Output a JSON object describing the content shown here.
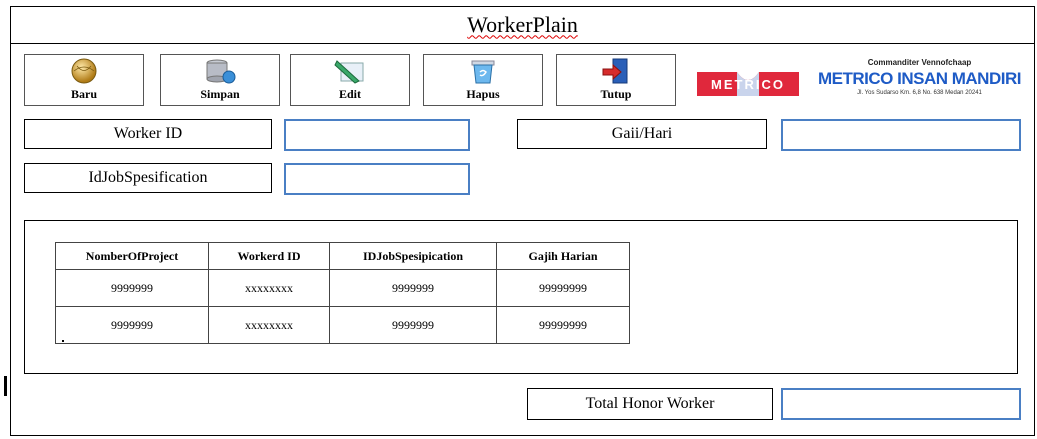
{
  "window": {
    "title": "WorkerPlain"
  },
  "toolbar": {
    "buttons": [
      {
        "label": "Baru",
        "icon": "globe-icon"
      },
      {
        "label": "Simpan",
        "icon": "database-save-icon"
      },
      {
        "label": "Edit",
        "icon": "edit-pencil-icon"
      },
      {
        "label": "Hapus",
        "icon": "recycle-bin-icon"
      },
      {
        "label": "Tutup",
        "icon": "exit-door-icon"
      }
    ]
  },
  "brand": {
    "logo_text": "METRICO",
    "company_type": "Commanditer Vennofchaap",
    "company_name": "METRICO INSAN MANDIRI",
    "address": "Jl. Yos Sudarso Km. 6,8 No. 638 Medan 20241"
  },
  "form": {
    "worker_id_label": "Worker ID",
    "worker_id_value": "",
    "gaji_label": "Gaii/Hari",
    "gaji_value": "",
    "idjob_label": "IdJobSpesification",
    "idjob_value": ""
  },
  "table": {
    "columns": [
      "NomberOfProject",
      "Workerd ID",
      "IDJobSpesipication",
      "Gajih Harian"
    ],
    "rows": [
      [
        "9999999",
        "xxxxxxxx",
        "9999999",
        "99999999"
      ],
      [
        "9999999",
        "xxxxxxxx",
        "9999999",
        "99999999"
      ]
    ]
  },
  "footer": {
    "total_label": "Total Honor Worker",
    "total_value": ""
  },
  "colors": {
    "field_border": "#4a7fc4",
    "brand_blue": "#1e5bc6",
    "logo_red": "#e0283c"
  }
}
